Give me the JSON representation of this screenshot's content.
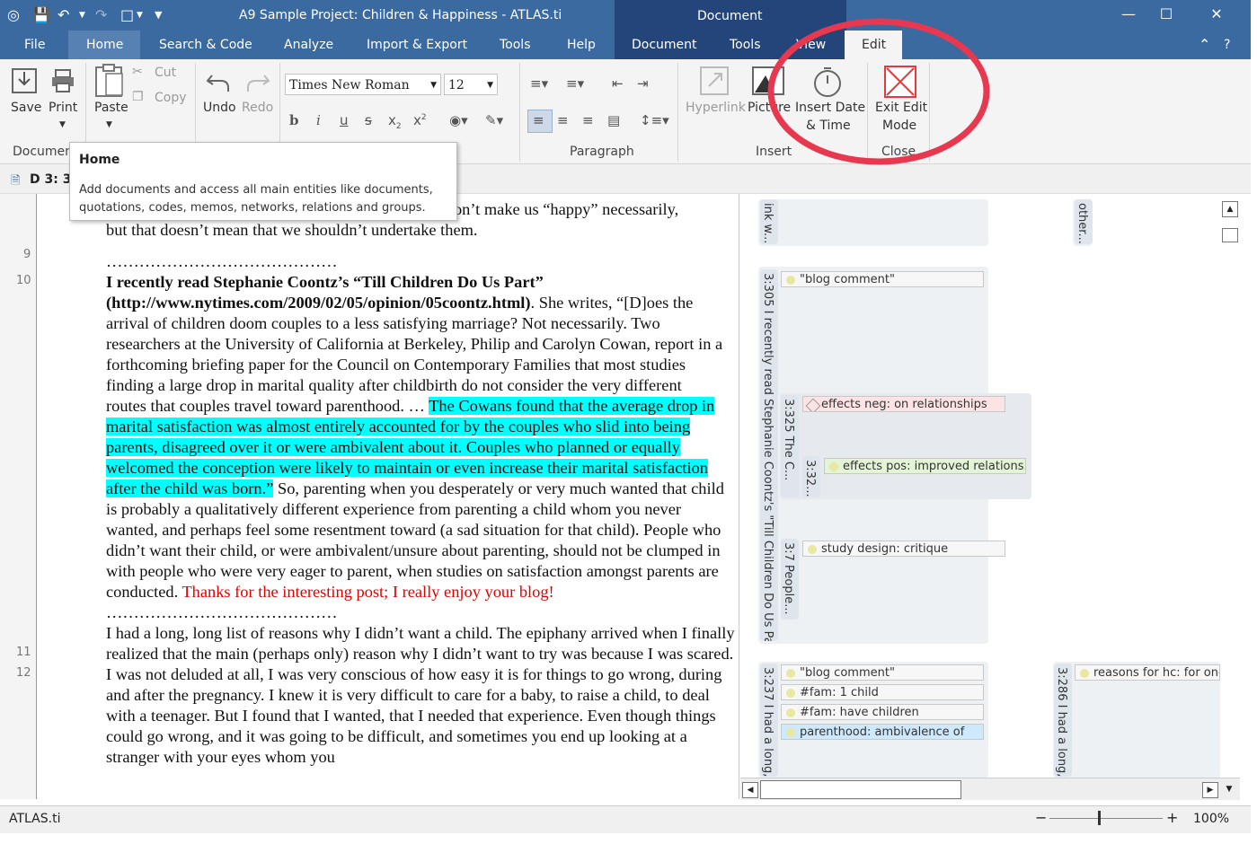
{
  "window": {
    "title": "A9 Sample Project: Children & Happiness - ATLAS.ti",
    "context_title": "Document"
  },
  "menu": [
    "File",
    "Home",
    "Search & Code",
    "Analyze",
    "Import & Export",
    "Tools",
    "Help",
    "Document",
    "Tools",
    "View",
    "Edit"
  ],
  "ribbon": {
    "save": "Save",
    "print": "Print",
    "paste": "Paste",
    "cut": "Cut",
    "copy": "Copy",
    "undo": "Undo",
    "redo": "Redo",
    "font_name": "Times New Roman",
    "font_size": "12",
    "hyperlink": "Hyperlink",
    "picture": "Picture",
    "insert_date_1": "Insert Date",
    "insert_date_2": "& Time",
    "exit_edit_1": "Exit Edit",
    "exit_edit_2": "Mode",
    "groups": {
      "documents": "Documen",
      "paragraph": "Paragraph",
      "insert": "Insert",
      "close": "Close"
    }
  },
  "tooltip": {
    "title": "Home",
    "text": "Add documents and access all main entities like documents, quotations, codes, memos, networks, relations and groups."
  },
  "doc_tab": {
    "label": "D 3: 3"
  },
  "line_numbers": [
    "9",
    "10",
    "11",
    "12"
  ],
  "document": {
    "top_partial_a": "y don’t make us “happy” necessarily,",
    "top_partial_b": "but that doesn’t mean that we shouldn’t undertake them.",
    "dots": "……………………………………",
    "p10_bold": "I recently read Stephanie Coontz’s “Till Children Do Us Part” (http://www.nytimes.com/2009/02/05/opinion/05coontz.html)",
    "p10_normal": ". She writes, “[D]oes the arrival of children doom couples to a less satisfying marriage? Not necessarily. Two researchers at the University of California at Berkeley, Philip and Carolyn Cowan, report in a forthcoming briefing paper for the Council on Contemporary Families that most studies finding a large drop in marital quality after childbirth do not consider the very different routes that couples travel toward parenthood. … ",
    "p10_highlight": "The Cowans found that the average drop in marital satisfaction was almost entirely accounted for by the couples who slid into being parents, disagreed over it or were ambivalent about it. Couples who planned or equally welcomed the conception were likely to maintain or even increase their marital satisfaction after the child was born.”",
    "p10_after": " So, parenting when you desperately or very much wanted that child is probably a qualitatively different experience from parenting a child whom you never wanted, and perhaps feel some resentment toward (a sad situation for that child). People who didn’t want their child, or were ambivalent/unsure about parenting, should not be clumped in with people who were very eager to parent, when studies on satisfaction amongst parents are conducted. ",
    "p10_red": "Thanks for the interesting post; I really enjoy your blog!",
    "p12": "I had a long, long list of reasons why I didn’t want a child. The epiphany arrived when I finally realized that the main (perhaps only) reason why I didn’t want to try was because I was scared. I was not deluded at all, I was very conscious of how easy it is for things to go wrong, during and after the pregnancy. I knew it is very difficult to care for a baby, to raise a child, to deal with a teenager. But I found that I wanted, that I needed that experience. Even though things could go wrong, and it was going to be difficult, and sometimes you end up looking at a stranger with your eyes whom you"
  },
  "margin": {
    "q_top_left": "ink w...",
    "q_top_right": "other...",
    "q305": "3:305 I recently read Stephanie Coontz's \"Till Children Do Us Par...",
    "q325": "3:325 The C...",
    "q332": "3:32...",
    "q37": "3:7 People...",
    "q237": "3:237 I had a long, lo",
    "q286": "3:286 I had a long, lo",
    "codes": {
      "blog_comment_1": "\"blog comment\"",
      "effects_neg": "effects neg: on relationships",
      "effects_pos": "effects pos: improved relations...",
      "study_design": "study design: critique",
      "blog_comment_2": "\"blog comment\"",
      "fam_1child": "#fam: 1 child",
      "fam_have": "#fam: have children",
      "parenthood": "parenthood: ambivalence of",
      "reasons": "reasons for hc: for ones"
    },
    "code_colors": {
      "neg": "#fde4e4",
      "pos": "#e4f4d6",
      "parenthood": "#cde9fb",
      "default": "#f7f7f7"
    }
  },
  "status": {
    "app": "ATLAS.ti",
    "zoom": "100%",
    "zoom_level": 0.6
  },
  "colors": {
    "title_bar": "#3a6aa0",
    "context_tab": "#23457a",
    "highlight": "#00ffff",
    "annotation_circle": "#e8384f"
  }
}
